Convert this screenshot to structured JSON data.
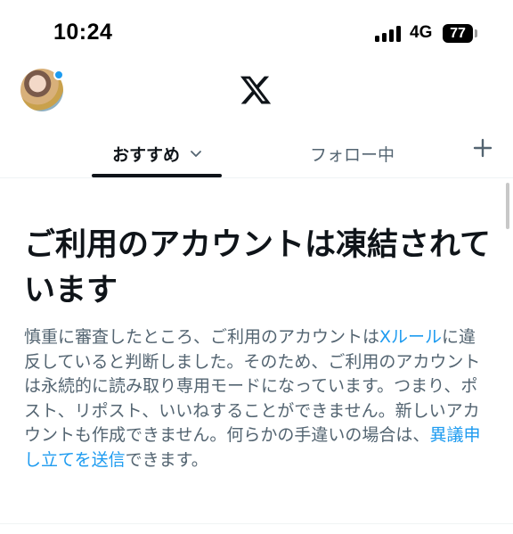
{
  "status_bar": {
    "time": "10:24",
    "network": "4G",
    "battery": "77"
  },
  "header": {
    "avatar": "user-avatar",
    "logo": "x-logo"
  },
  "tabs": {
    "recommended": "おすすめ",
    "following": "フォロー中"
  },
  "notice": {
    "title": "ご利用のアカウントは凍結されています",
    "body_part1": "慎重に審査したところ、ご利用のアカウントは",
    "link_rules": "Xルール",
    "body_part2": "に違反していると判断しました。そのため、ご利用のアカウントは永続的に読み取り専用モードになっています。つまり、ポスト、リポスト、いいねすることができません。新しいアカウントも作成できません。何らかの手違いの場合は、",
    "link_appeal": "異議申し立てを送信",
    "body_part3": "できます。"
  },
  "colors": {
    "accent": "#1d9bf0",
    "text_primary": "#0f1419",
    "text_secondary": "#536471"
  }
}
